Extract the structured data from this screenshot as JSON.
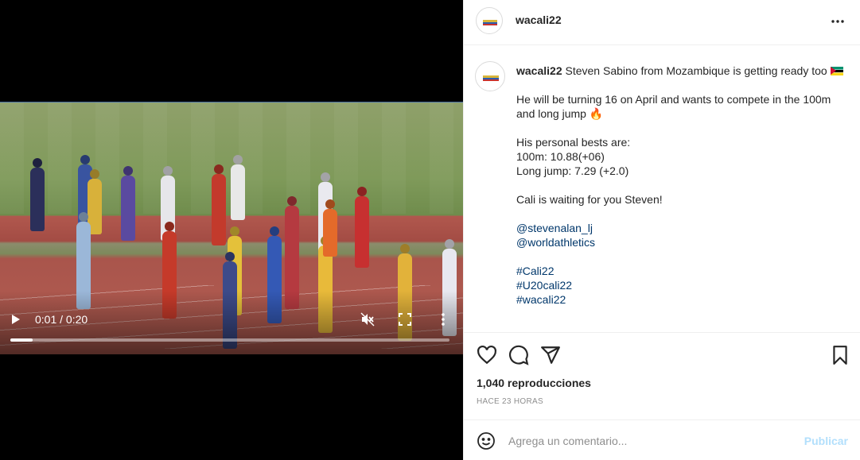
{
  "video": {
    "time_display": "0:01 / 0:20",
    "progress": 0.05,
    "icons": [
      "play-icon",
      "mute-icon",
      "fullscreen-icon",
      "more-vertical-icon"
    ]
  },
  "header": {
    "username": "wacali22",
    "more_icon": "more-horizontal-icon"
  },
  "caption": {
    "username": "wacali22",
    "line1": "Steven Sabino from Mozambique is getting ready too",
    "flag_icon": "mozambique-flag-icon",
    "para2_line1": "He will be turning 16 on April and wants to compete in the 100m",
    "para2_line2": "and long jump 🔥",
    "para3_line1": "His personal bests are:",
    "para3_line2": "100m: 10.88(+06)",
    "para3_line3": "Long jump: 7.29 (+2.0)",
    "para4": "Cali is waiting for you Steven!",
    "mention1": "@stevenalan_lj",
    "mention2": "@worldathletics",
    "tag1": "#Cali22",
    "tag2": "#U20cali22",
    "tag3": "#wacali22"
  },
  "actions": {
    "icons": [
      "heart-icon",
      "comment-icon",
      "share-icon",
      "bookmark-icon"
    ]
  },
  "stats": {
    "views": "1,040 reproducciones",
    "time_ago": "HACE 23 HORAS"
  },
  "comment": {
    "placeholder": "Agrega un comentario...",
    "publish_label": "Publicar",
    "emoji_icon": "emoji-icon"
  },
  "colors": {
    "link": "#00376b",
    "publish_disabled": "#b2dffc",
    "muted_text": "#8e8e8e"
  }
}
